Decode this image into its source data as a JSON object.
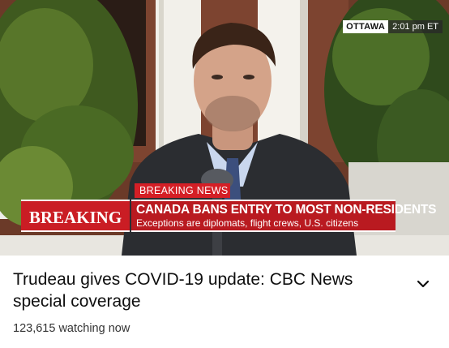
{
  "overlay": {
    "location": "OTTAWA",
    "time": "2:01 pm ET"
  },
  "lower_third": {
    "kicker": "BREAKING NEWS",
    "flag": "BREAKING",
    "headline": "CANADA BANS ENTRY TO MOST NON-RESIDENTS",
    "subline": "Exceptions are diplomats, flight crews, U.S. citizens"
  },
  "video": {
    "title": "Trudeau gives COVID-19 update: CBC News special coverage",
    "viewers": "123,615 watching now"
  },
  "icons": {
    "expand": "chevron-down-icon"
  },
  "colors": {
    "breaking_red": "#ca1d24",
    "banner_red": "#b91a20",
    "title_text": "#0f0f0f"
  }
}
